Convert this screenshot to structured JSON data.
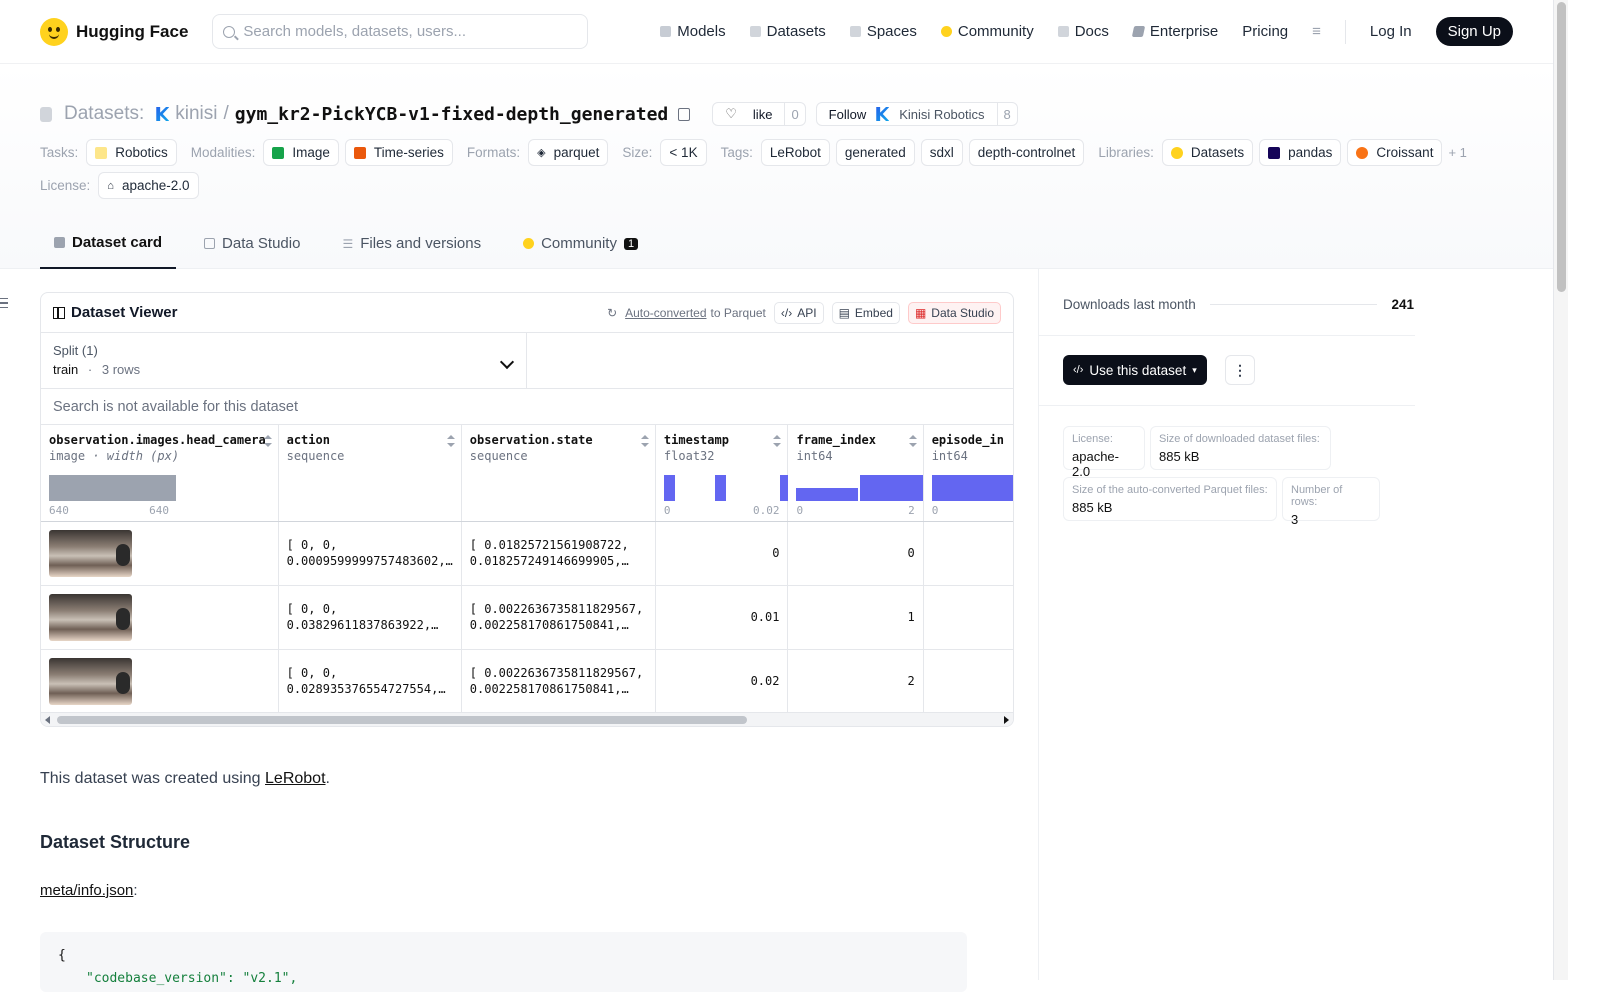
{
  "nav": {
    "brand": "Hugging Face",
    "search_placeholder": "Search models, datasets, users...",
    "links": [
      "Models",
      "Datasets",
      "Spaces",
      "Community",
      "Docs",
      "Enterprise",
      "Pricing"
    ],
    "login": "Log In",
    "signup": "Sign Up"
  },
  "header": {
    "section": "Datasets:",
    "owner": "kinisi",
    "slash": "/",
    "name": "gym_kr2-PickYCB-v1-fixed-depth_generated",
    "like_label": "like",
    "like_count": "0",
    "follow_label": "Follow",
    "org": "Kinisi Robotics",
    "follow_count": "8"
  },
  "meta": {
    "tasks_label": "Tasks:",
    "tasks": [
      "Robotics"
    ],
    "modalities_label": "Modalities:",
    "modalities": [
      "Image",
      "Time-series"
    ],
    "formats_label": "Formats:",
    "formats": [
      "parquet"
    ],
    "size_label": "Size:",
    "size": "< 1K",
    "tags_label": "Tags:",
    "tags": [
      "LeRobot",
      "generated",
      "sdxl",
      "depth-controlnet"
    ],
    "libraries_label": "Libraries:",
    "libraries": [
      "Datasets",
      "pandas",
      "Croissant"
    ],
    "libraries_more": "+ 1",
    "license_label": "License:",
    "license": "apache-2.0"
  },
  "tabs": [
    {
      "label": "Dataset card",
      "active": true
    },
    {
      "label": "Data Studio"
    },
    {
      "label": "Files and versions"
    },
    {
      "label": "Community",
      "badge": "1"
    }
  ],
  "viewer": {
    "title": "Dataset Viewer",
    "auto_converted": "Auto-converted",
    "to_parquet": "to Parquet",
    "api": "API",
    "embed": "Embed",
    "data_studio": "Data Studio",
    "split_label": "Split (1)",
    "split_value": "train",
    "split_dot": "·",
    "split_rows": "3 rows",
    "search_na": "Search is not available for this dataset",
    "columns": [
      {
        "name": "observation.images.head_camera",
        "type": "image",
        "extra": "· width (px)",
        "min": "640",
        "max": "640"
      },
      {
        "name": "action",
        "type": "sequence"
      },
      {
        "name": "observation.state",
        "type": "sequence"
      },
      {
        "name": "timestamp",
        "type": "float32",
        "min": "0",
        "max": "0.02"
      },
      {
        "name": "frame_index",
        "type": "int64",
        "min": "0",
        "max": "2"
      },
      {
        "name": "episode_in",
        "type": "int64",
        "min": "0"
      }
    ],
    "rows": [
      {
        "action": [
          "[ 0, 0,",
          "0.0009599999757483602,…"
        ],
        "state": [
          "[ 0.01825721561908722,",
          "0.018257249146699905,…"
        ],
        "timestamp": "0",
        "frame_index": "0"
      },
      {
        "action": [
          "[ 0, 0,",
          "0.03829611837863922,…"
        ],
        "state": [
          "[ 0.0022636735811829567,",
          "0.002258170861750841,…"
        ],
        "timestamp": "0.01",
        "frame_index": "1"
      },
      {
        "action": [
          "[ 0, 0,",
          "0.028935376554727554,…"
        ],
        "state": [
          "[ 0.0022636735811829567,",
          "0.002258170861750841,…"
        ],
        "timestamp": "0.02",
        "frame_index": "2"
      }
    ]
  },
  "card": {
    "intro_pre": "This dataset was created using ",
    "intro_link": "LeRobot",
    "intro_post": ".",
    "structure_heading": "Dataset Structure",
    "info_link": "meta/info.json",
    "info_colon": ":",
    "code_line1": "{",
    "code_line2": "\"codebase_version\": \"v2.1\","
  },
  "sidebar": {
    "downloads_label": "Downloads last month",
    "downloads": "241",
    "use_dataset": "Use this dataset",
    "more": "⋮",
    "cards": [
      {
        "k": "License:",
        "v": "apache-2.0"
      },
      {
        "k": "Size of downloaded dataset files:",
        "v": "885 kB"
      },
      {
        "k": "Size of the auto-converted Parquet files:",
        "v": "885 kB"
      },
      {
        "k": "Number of rows:",
        "v": "3"
      }
    ]
  },
  "colors": {
    "accent": "#6366f1",
    "dark": "#0b0f19",
    "brand": "#ffd21e"
  }
}
